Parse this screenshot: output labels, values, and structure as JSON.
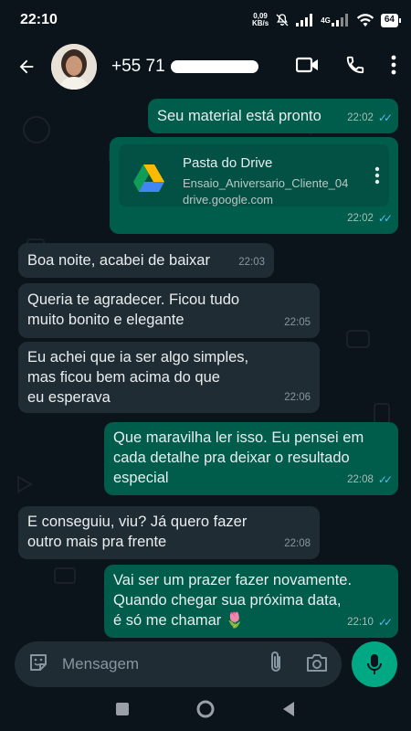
{
  "status_bar": {
    "time": "22:10",
    "net_speed": "0,09",
    "net_unit": "KB/s",
    "network": "4G",
    "battery": "64"
  },
  "header": {
    "contact": "+55 71"
  },
  "messages": [
    {
      "dir": "out",
      "text": "Seu material está pronto",
      "time": "22:02",
      "read": true
    },
    {
      "dir": "out",
      "type": "drive",
      "card_title": "Pasta do Drive",
      "card_file": "Ensaio_Aniversario_Cliente_04",
      "card_url": "drive.google.com",
      "time": "22:02",
      "read": true
    },
    {
      "dir": "in",
      "text": "Boa noite, acabei de baixar",
      "time": "22:03"
    },
    {
      "dir": "in",
      "lines": [
        "Queria te agradecer. Ficou tudo",
        "muito bonito e elegante"
      ],
      "time": "22:05"
    },
    {
      "dir": "in",
      "lines": [
        "Eu achei que ia ser algo simples,",
        "mas ficou bem acima do que",
        "eu esperava"
      ],
      "time": "22:06"
    },
    {
      "dir": "out",
      "lines": [
        "Que maravilha ler isso. Eu pensei em",
        "cada detalhe pra deixar o resultado",
        "especial"
      ],
      "time": "22:08",
      "read": true
    },
    {
      "dir": "in",
      "lines": [
        "E conseguiu, viu? Já quero fazer",
        "outro mais pra frente"
      ],
      "time": "22:08"
    },
    {
      "dir": "out",
      "lines": [
        "Vai ser um prazer fazer novamente.",
        "Quando chegar sua próxima data,",
        "é só me chamar 🌷"
      ],
      "time": "22:10",
      "read": true
    }
  ],
  "composer": {
    "placeholder": "Mensagem"
  },
  "colors": {
    "background": "#0b141a",
    "outgoing": "#005c4b",
    "incoming": "#202c33",
    "accent": "#00a884",
    "read_ticks": "#53bdeb"
  }
}
